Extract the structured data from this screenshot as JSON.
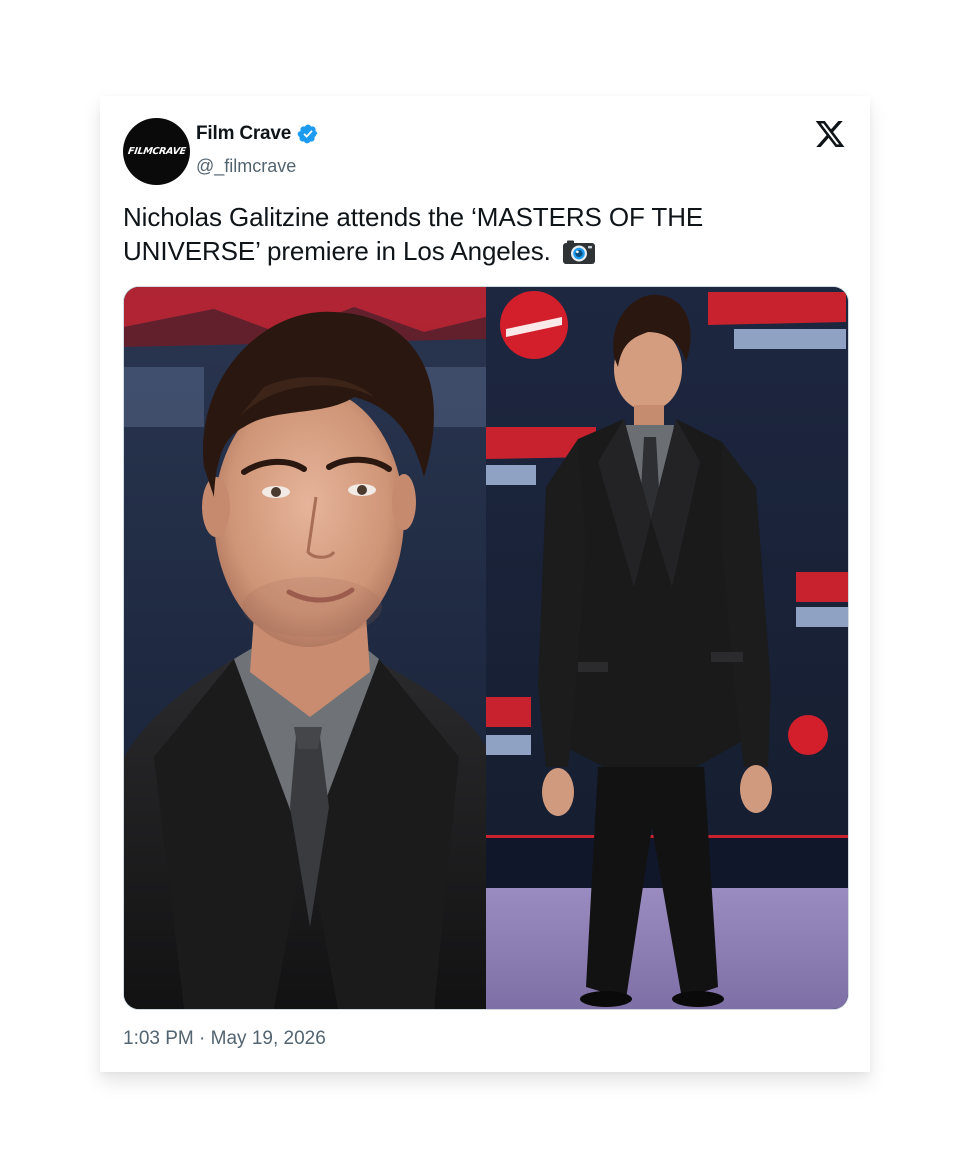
{
  "tweet": {
    "author": {
      "display_name": "Film Crave",
      "handle": "@_filmcrave",
      "avatar_text": "FILMCRAVE",
      "verified": true
    },
    "text": "Nicholas Galitzine attends the ‘MASTERS OF THE UNIVERSE’ premiere in Los Angeles.",
    "text_emoji_icon": "camera-icon",
    "timestamp": "1:03 PM · May 19, 2026",
    "platform_icon": "x-logo-icon"
  },
  "media": {
    "images": [
      {
        "name": "closeup-portrait-photo"
      },
      {
        "name": "full-length-red-carpet-photo"
      }
    ]
  },
  "colors": {
    "verified_blue": "#1d9bf0",
    "text_primary": "#0f1419",
    "text_secondary": "#536471",
    "backdrop_navy": "#1b2436",
    "carpet_purple": "#8e7fb3",
    "brand_red": "#d21f2b"
  }
}
